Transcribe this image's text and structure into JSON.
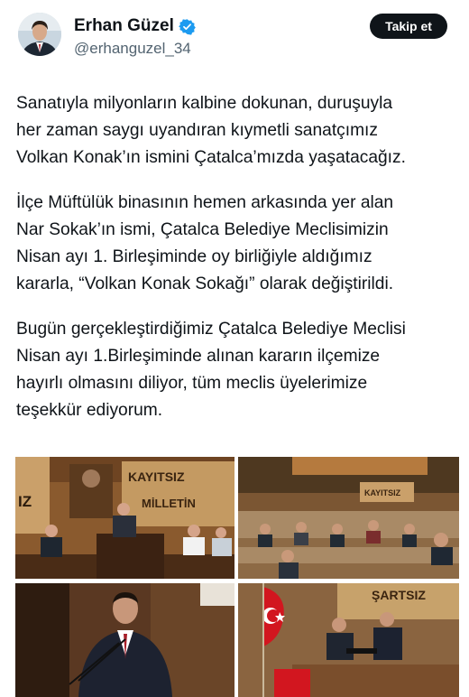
{
  "author": {
    "name": "Erhan Güzel",
    "handle": "@erhanguzel_34",
    "verified": true,
    "verified_color": "#1d9bf0"
  },
  "follow_button": {
    "label": "Takip et"
  },
  "tweet": {
    "paragraphs": [
      "Sanatıyla milyonların kalbine dokunan, duruşuyla\nher zaman saygı uyandıran kıymetli sanatçımız\nVolkan Konak’ın ismini Çatalca’mızda yaşatacağız.",
      "İlçe Müftülük binasının hemen arkasında yer alan\nNar Sokak’ın ismi, Çatalca Belediye Meclisimizin\nNisan ayı 1. Birleşiminde oy birliğiyle aldığımız\nkararla, “Volkan Konak Sokağı” olarak değiştirildi.",
      "Bugün gerçekleştirdiğimiz Çatalca Belediye Meclisi\nNisan ayı 1.Birleşiminde alınan kararın ilçemize\nhayırlı olmasını diliyor, tüm meclis üyelerimize\nteşekkür ediyorum."
    ]
  },
  "media": {
    "photos": [
      {
        "name": "council-hall-photo",
        "wall_text": "KAYITSIZ",
        "wall_text_2": "MİLLETİN",
        "left_text": "IZ"
      },
      {
        "name": "council-members-photo",
        "wall_text": "KAYITSIZ"
      },
      {
        "name": "speaker-podium-photo"
      },
      {
        "name": "presidium-desk-photo",
        "wall_text": "ŞARTSIZ"
      }
    ]
  }
}
